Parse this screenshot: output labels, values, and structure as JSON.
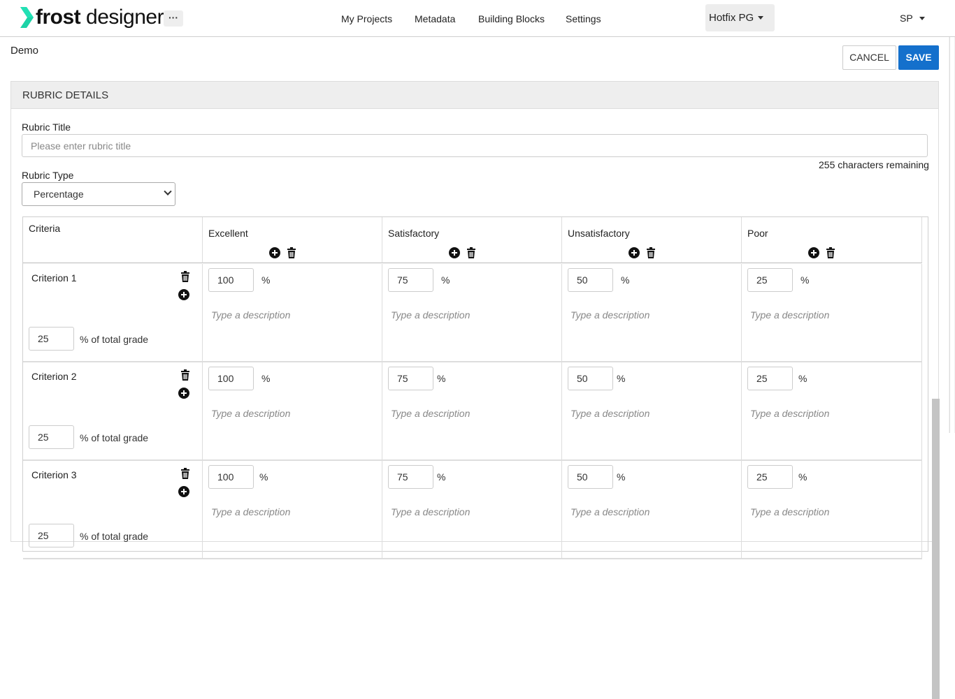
{
  "brand": {
    "name_bold": "frost",
    "name_regular": " designer",
    "accent_color": "#1dd3a7"
  },
  "nav": {
    "more": "···",
    "items": [
      "My Projects",
      "Metadata",
      "Building Blocks",
      "Settings"
    ],
    "environment": "Hotfix PG",
    "user": "SP"
  },
  "page": {
    "title": "Demo",
    "cancel_label": "CANCEL",
    "save_label": "SAVE",
    "save_color": "#1470cc"
  },
  "panel": {
    "heading": "RUBRIC DETAILS",
    "title_label": "Rubric Title",
    "title_placeholder": "Please enter rubric title",
    "title_value": "",
    "chars_remaining": "255 characters remaining",
    "type_label": "Rubric Type",
    "type_value": "Percentage"
  },
  "grid": {
    "criteria_header": "Criteria",
    "levels": [
      "Excellent",
      "Satisfactory",
      "Unsatisfactory",
      "Poor"
    ],
    "level_values": [
      "100",
      "75",
      "50",
      "25"
    ],
    "pct_sign": "%",
    "desc_placeholder": "Type a description",
    "total_suffix": "% of total grade",
    "criteria": [
      {
        "name": "Criterion 1",
        "weight": "25"
      },
      {
        "name": "Criterion 2",
        "weight": "25"
      },
      {
        "name": "Criterion 3",
        "weight": "25"
      }
    ]
  }
}
